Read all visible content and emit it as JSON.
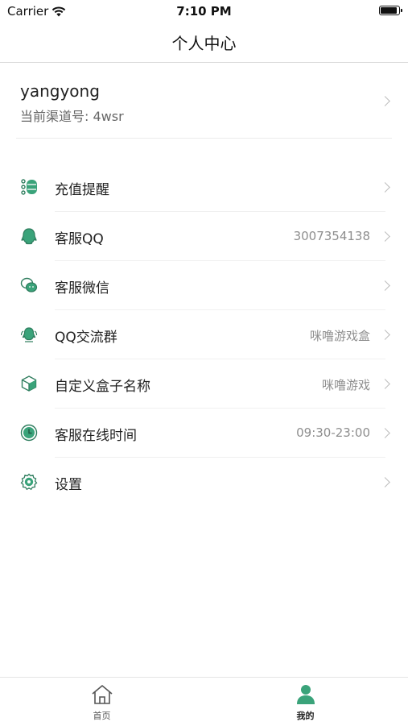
{
  "status_bar": {
    "carrier": "Carrier",
    "time": "7:10 PM",
    "battery_level": 0.95
  },
  "nav": {
    "title": "个人中心"
  },
  "profile": {
    "username": "yangyong",
    "channel": "当前渠道号: 4wsr"
  },
  "menu": {
    "items": [
      {
        "label": "充值提醒",
        "value": "",
        "icon": "list-icon"
      },
      {
        "label": "客服QQ",
        "value": "3007354138",
        "icon": "qq-icon"
      },
      {
        "label": "客服微信",
        "value": "",
        "icon": "wechat-icon"
      },
      {
        "label": "QQ交流群",
        "value": "咪噜游戏盒",
        "icon": "qq-group-icon"
      },
      {
        "label": "自定义盒子名称",
        "value": "咪噜游戏",
        "icon": "box-icon"
      },
      {
        "label": "客服在线时间",
        "value": "09:30-23:00",
        "icon": "clock-icon"
      },
      {
        "label": "设置",
        "value": "",
        "icon": "gear-icon"
      }
    ]
  },
  "tabs": [
    {
      "label": "首页",
      "icon": "home-icon",
      "active": false
    },
    {
      "label": "我的",
      "icon": "person-icon",
      "active": true
    }
  ],
  "colors": {
    "accent": "#3aa37a",
    "inactive": "#555555",
    "chevron": "#bdbdbd",
    "value_text": "#8e8e8e"
  }
}
